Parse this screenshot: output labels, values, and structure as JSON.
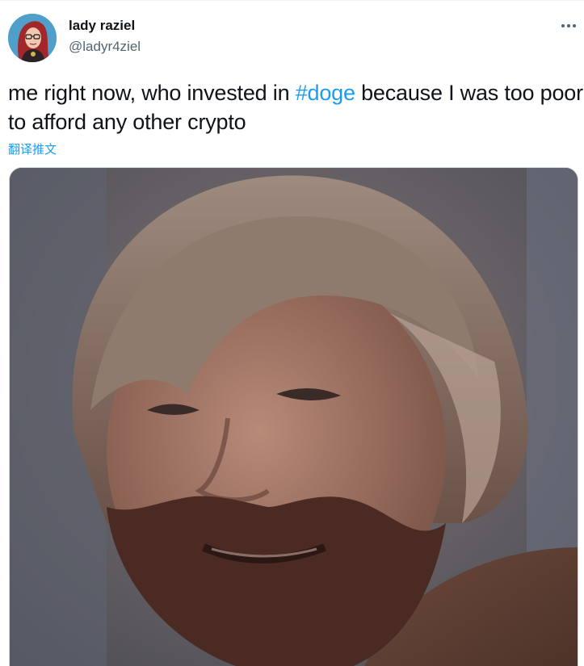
{
  "author": {
    "display_name": "lady raziel",
    "handle": "@ladyr4ziel",
    "avatar_icon": "profile-avatar-illustration"
  },
  "menu": {
    "more_icon": "more-horizontal-icon"
  },
  "tweet": {
    "text_before_hashtag": "me right now, who invested in ",
    "hashtag": "#doge",
    "text_after_hashtag": " because I was too poor to afford any other crypto",
    "translate_label": "翻译推文"
  },
  "media": {
    "kind": "photo",
    "subject": "bearded-man-smiling"
  },
  "colors": {
    "link": "#1d9bf0",
    "text": "#0f1419",
    "secondary_text": "#536471",
    "border": "#cfd9de"
  }
}
